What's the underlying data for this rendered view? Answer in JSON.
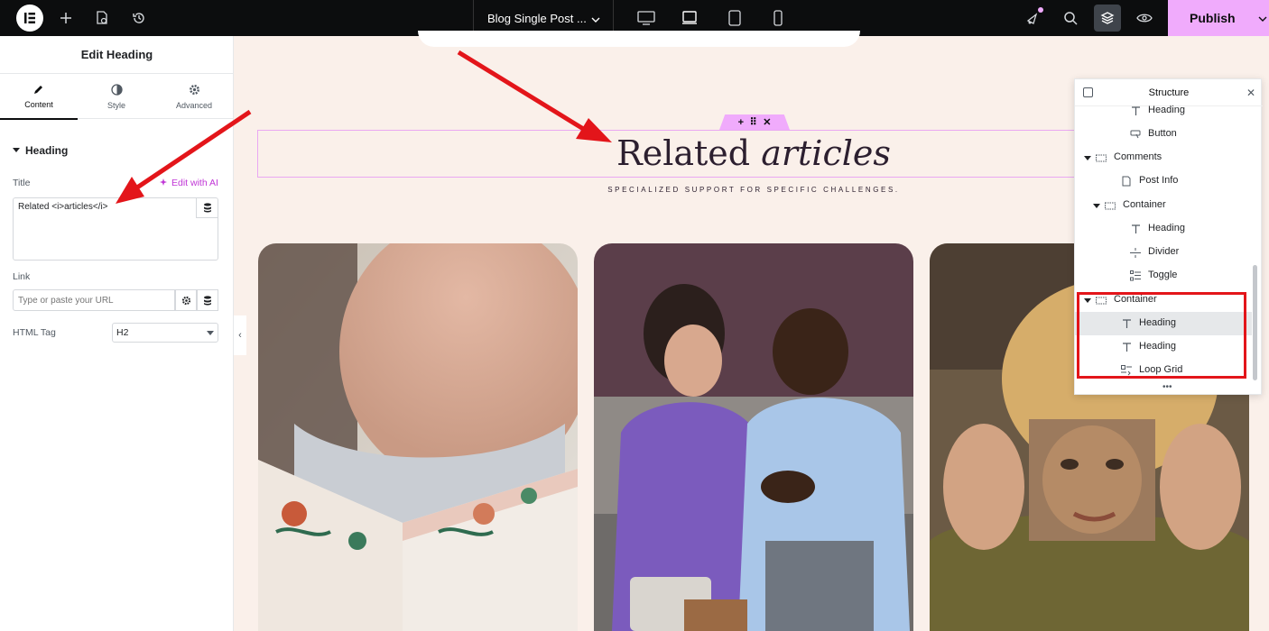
{
  "topbar": {
    "document_title": "Blog Single Post ...",
    "publish_label": "Publish"
  },
  "panel": {
    "title": "Edit Heading",
    "tabs": [
      {
        "label": "Content"
      },
      {
        "label": "Style"
      },
      {
        "label": "Advanced"
      }
    ],
    "section": "Heading",
    "title_label": "Title",
    "edit_ai_label": "Edit with AI",
    "title_value": "Related <i>articles</i>",
    "link_label": "Link",
    "link_placeholder": "Type or paste your URL",
    "html_tag_label": "HTML Tag",
    "html_tag_value": "H2"
  },
  "canvas": {
    "heading_text_regular": "Related",
    "heading_text_italic": "articles",
    "subheading": "SPECIALIZED SUPPORT FOR SPECIFIC CHALLENGES."
  },
  "structure": {
    "title": "Structure",
    "rows": [
      {
        "label": "Heading",
        "icon": "heading-icon"
      },
      {
        "label": "Button",
        "icon": "button-icon"
      },
      {
        "label": "Comments",
        "icon": "container-icon",
        "expanded": true
      },
      {
        "label": "Post Info",
        "icon": "post-info-icon"
      },
      {
        "label": "Container",
        "icon": "container-icon",
        "expanded": true
      },
      {
        "label": "Heading",
        "icon": "heading-icon"
      },
      {
        "label": "Divider",
        "icon": "divider-icon"
      },
      {
        "label": "Toggle",
        "icon": "toggle-icon"
      },
      {
        "label": "Container",
        "icon": "container-icon",
        "expanded": true
      },
      {
        "label": "Heading",
        "icon": "heading-icon",
        "selected": true
      },
      {
        "label": "Heading",
        "icon": "heading-icon"
      },
      {
        "label": "Loop Grid",
        "icon": "loop-grid-icon"
      }
    ]
  },
  "colors": {
    "accent": "#f0abfc",
    "annotation": "#e3151a",
    "canvas_bg": "#faf0ea"
  }
}
